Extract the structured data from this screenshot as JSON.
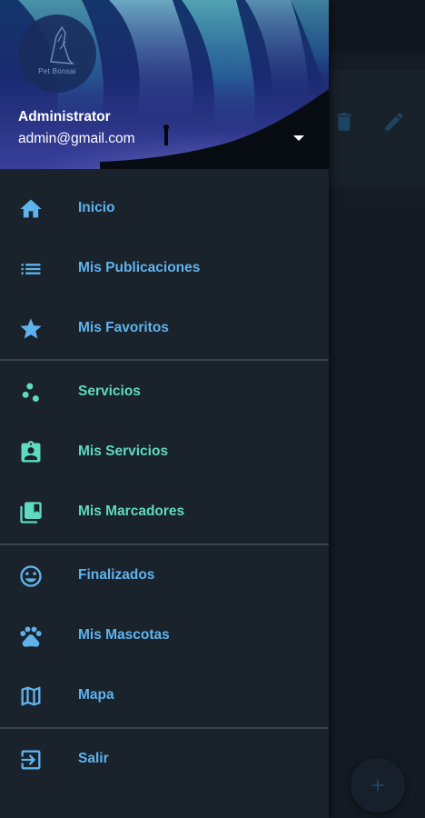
{
  "header": {
    "avatar_text": "Pet Bonsai",
    "user_name": "Administrator",
    "user_email": "admin@gmail.com"
  },
  "menu": {
    "groups": [
      [
        {
          "label": "Inicio",
          "icon": "home-icon"
        },
        {
          "label": "Mis Publicaciones",
          "icon": "list-icon"
        },
        {
          "label": "Mis Favoritos",
          "icon": "star-icon"
        }
      ],
      [
        {
          "label": "Servicios",
          "icon": "scatter-icon"
        },
        {
          "label": "Mis Servicios",
          "icon": "contact-badge-icon"
        },
        {
          "label": "Mis Marcadores",
          "icon": "library-icon"
        }
      ],
      [
        {
          "label": "Finalizados",
          "icon": "smile-icon"
        },
        {
          "label": "Mis Mascotas",
          "icon": "paw-icon"
        },
        {
          "label": "Mapa",
          "icon": "map-icon"
        }
      ],
      [
        {
          "label": "Salir",
          "icon": "exit-icon"
        }
      ]
    ]
  },
  "colors": {
    "drawer_bg": "#1a222c",
    "blue_accent": "#5fb3ec",
    "green_accent": "#5fd9c0",
    "divider": "#394350",
    "background_app": "#141b23"
  },
  "background": {
    "toolbar_icons": [
      "delete-icon",
      "edit-icon"
    ],
    "fab_icon": "add-icon"
  }
}
